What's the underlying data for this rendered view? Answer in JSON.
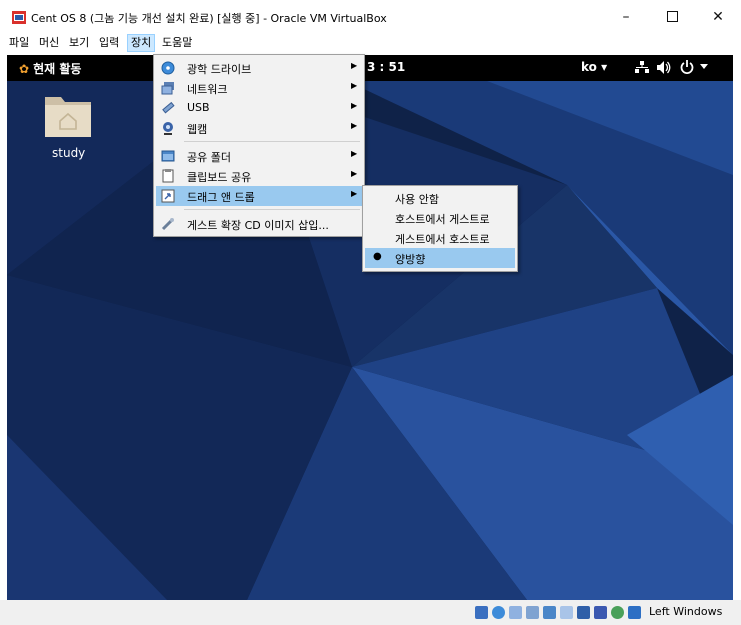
{
  "window": {
    "title": "Cent OS 8 (그놈 기능 개선 설치 완료) [실행 중] - Oracle VM VirtualBox",
    "minimize": "–",
    "close": "✕"
  },
  "menubar": {
    "items": [
      "파일",
      "머신",
      "보기",
      "입력",
      "장치",
      "도움말"
    ]
  },
  "guest": {
    "activities": "현재 활동",
    "clock": "3 : 51",
    "input_method": "ko ▾",
    "desktop_icon_label": "study"
  },
  "devices_menu": {
    "items": [
      {
        "label": "광학 드라이브",
        "icon": "optical-drive-icon"
      },
      {
        "label": "네트워크",
        "icon": "network-icon"
      },
      {
        "label": "USB",
        "icon": "usb-icon"
      },
      {
        "label": "웹캠",
        "icon": "webcam-icon"
      },
      {
        "label": "공유 폴더",
        "icon": "shared-folder-icon"
      },
      {
        "label": "클립보드 공유",
        "icon": "clipboard-icon"
      },
      {
        "label": "드래그 앤 드롭",
        "icon": "drag-drop-icon"
      },
      {
        "label": "게스트 확장 CD 이미지 삽입...",
        "icon": "guest-additions-icon"
      }
    ],
    "arrow": "▶"
  },
  "dnd_submenu": {
    "items": [
      "사용 안함",
      "호스트에서 게스트로",
      "게스트에서 호스트로",
      "양방향"
    ],
    "selected_bullet": "●"
  },
  "statusbar": {
    "host_key": "Left Windows"
  },
  "colors": {
    "menu_highlight": "#99c9ef",
    "guest_bg": "#0f2248"
  }
}
